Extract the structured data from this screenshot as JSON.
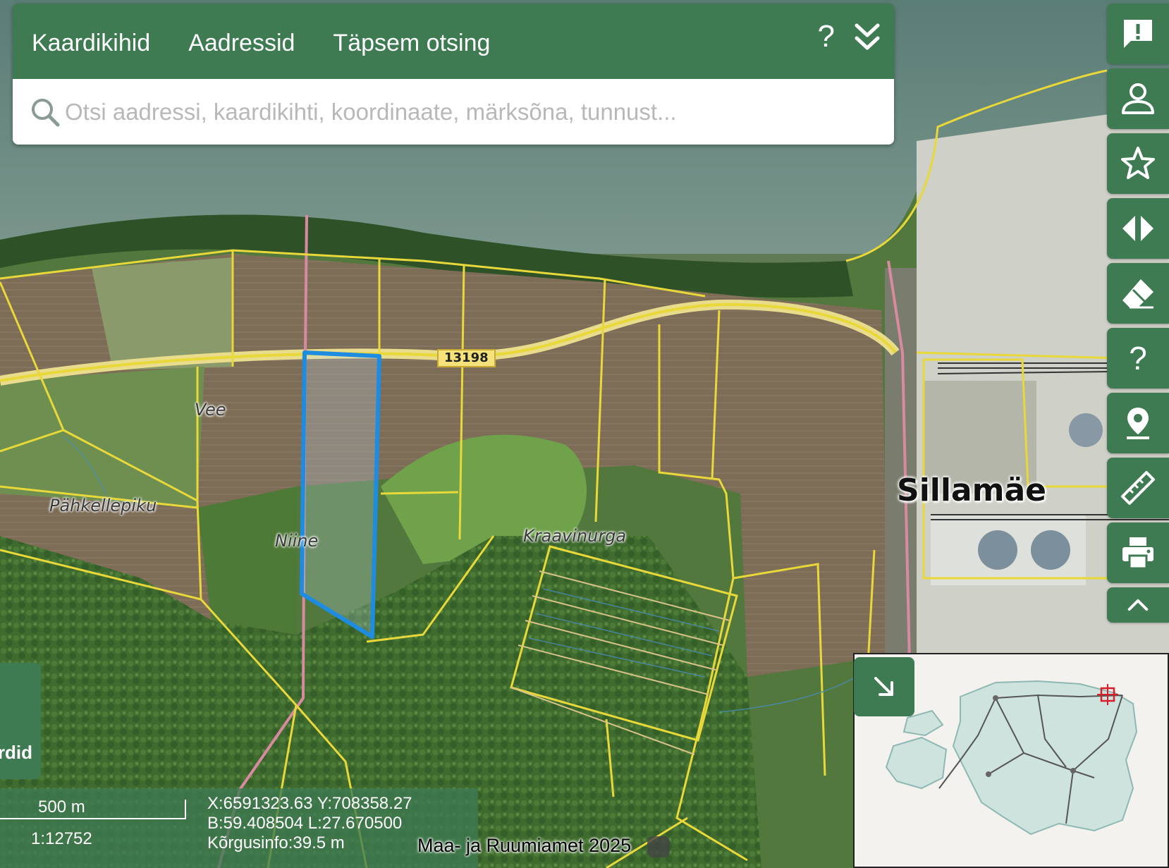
{
  "search": {
    "tabs": [
      "Kaardikihid",
      "Aadressid",
      "Täpsem otsing"
    ],
    "help_label": "?",
    "placeholder": "Otsi aadressi, kaardikihti, koordinaate, märksõna, tunnust..."
  },
  "toolbar": {
    "buttons": [
      {
        "name": "feedback",
        "icon": "feedback-icon"
      },
      {
        "name": "account",
        "icon": "user-icon"
      },
      {
        "name": "favorites",
        "icon": "star-icon"
      },
      {
        "name": "compare",
        "icon": "swipe-compare-icon"
      },
      {
        "name": "erase",
        "icon": "eraser-icon"
      },
      {
        "name": "help",
        "icon": "help-icon",
        "label": "?"
      },
      {
        "name": "location",
        "icon": "location-pin-icon"
      },
      {
        "name": "measure",
        "icon": "ruler-icon"
      },
      {
        "name": "print",
        "icon": "printer-icon"
      },
      {
        "name": "collapse",
        "icon": "chevron-up-icon"
      }
    ]
  },
  "map": {
    "labels": {
      "vee": "Vee",
      "pahkellepiku": "Pähkellepiku",
      "niine": "Niine",
      "kraavinurga": "Kraavinurga",
      "city": "Sillamäe"
    },
    "road_number": "13198"
  },
  "left_tab": {
    "label": "Kaardid"
  },
  "scale": {
    "length": "500 m",
    "ratio": "1:12752"
  },
  "coordinates": {
    "xy": "X:6591323.63 Y:708358.27",
    "bl": "B:59.408504 L:27.670500",
    "height": "Kõrgusinfo:39.5 m"
  },
  "copyright": "Maa- ja Ruumiamet 2025",
  "colors": {
    "panel_green": "#3e7a52",
    "parcel_border": "#e8d83a",
    "selected_parcel": "#1e8ce0",
    "sea": "#6f8b85"
  }
}
